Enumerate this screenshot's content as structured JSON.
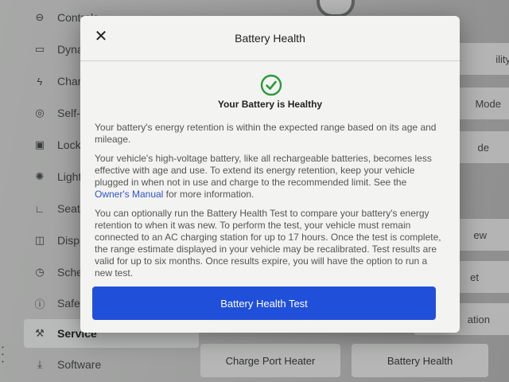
{
  "background": {
    "sidebar": {
      "items": [
        {
          "label": "Controls",
          "icon": "toggle-icon",
          "glyph": "⊖"
        },
        {
          "label": "Dynamics",
          "icon": "car-icon",
          "glyph": "▭"
        },
        {
          "label": "Charging",
          "icon": "bolt-icon",
          "glyph": "ϟ"
        },
        {
          "label": "Self-Driving",
          "icon": "steering-wheel-icon",
          "glyph": "◎"
        },
        {
          "label": "Locks",
          "icon": "lock-icon",
          "glyph": "▣"
        },
        {
          "label": "Lights",
          "icon": "light-icon",
          "glyph": "✺"
        },
        {
          "label": "Seat",
          "icon": "seat-icon",
          "glyph": "∟"
        },
        {
          "label": "Display",
          "icon": "display-icon",
          "glyph": "◫"
        },
        {
          "label": "Schedule",
          "icon": "alarm-clock-icon",
          "glyph": "◷"
        },
        {
          "label": "Safety",
          "icon": "info-icon",
          "glyph": "ⓘ"
        },
        {
          "label": "Service",
          "icon": "wrench-icon",
          "glyph": "🔧"
        },
        {
          "label": "Software",
          "icon": "download-icon",
          "glyph": "⤓"
        }
      ]
    },
    "right_buttons": [
      "ility",
      "Mode",
      "de",
      "ew",
      "et",
      "ation"
    ],
    "bottom_buttons": {
      "charge_port_heater": "Charge Port Heater",
      "battery_health": "Battery Health"
    }
  },
  "modal": {
    "title": "Battery Health",
    "close_icon": "close-icon",
    "status_icon": "check-circle-icon",
    "status_color": "#2a9a3a",
    "status_text": "Your Battery is Healthy",
    "paragraph1": "Your battery's energy retention is within the expected range based on its age and mileage.",
    "paragraph2_before_link": "Your vehicle's high-voltage battery, like all rechargeable batteries, becomes less effective with age and use. To extend its energy retention, keep your vehicle plugged in when not in use and charge to the recommended limit. See the ",
    "paragraph2_link": "Owner's Manual",
    "paragraph2_after_link": " for more information.",
    "paragraph3": "You can optionally run the Battery Health Test to compare your battery's energy retention to when it was new. To perform the test, your vehicle must remain connected to an AC charging station for up to 17 hours. Once the test is complete, the range estimate displayed in your vehicle may be recalibrated. Test results are valid for up to six months. Once results expire, you will have the option to run a new test.",
    "primary_button": "Battery Health Test",
    "accent_color": "#2050d9"
  }
}
